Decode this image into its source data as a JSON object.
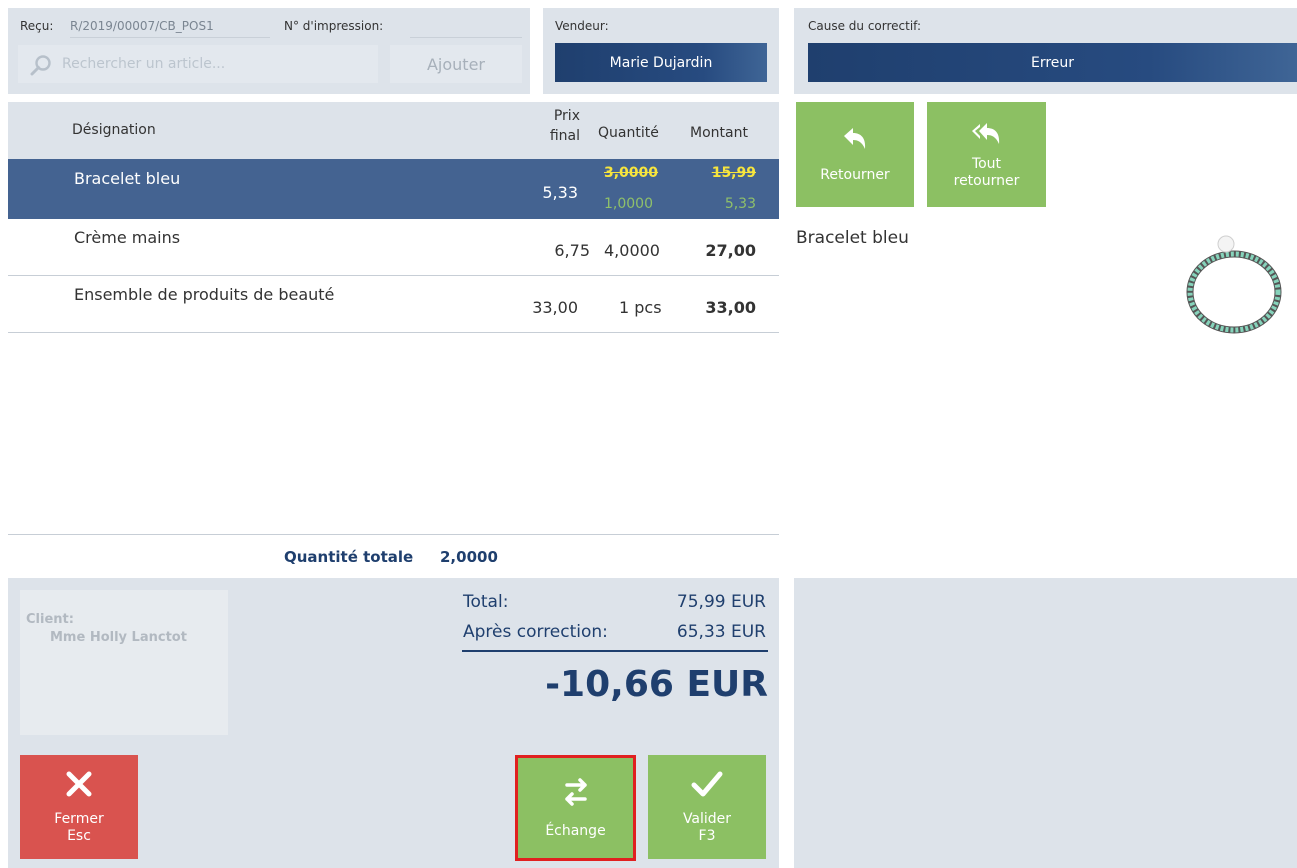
{
  "header": {
    "receipt_label": "Reçu:",
    "receipt_value": "R/2019/00007/CB_POS1",
    "print_label": "N° d'impression:",
    "print_value": "",
    "search_placeholder": "Rechercher un article...",
    "add_button": "Ajouter",
    "seller_label": "Vendeur:",
    "seller_value": "Marie Dujardin",
    "cause_label": "Cause du correctif:",
    "cause_value": "Erreur"
  },
  "table": {
    "col_designation": "Désignation",
    "col_price_line1": "Prix",
    "col_price_line2": "final",
    "col_quantity": "Quantité",
    "col_amount": "Montant",
    "rows": [
      {
        "name": "Bracelet bleu",
        "price": "5,33",
        "qty_old": "3,0000",
        "qty_new": "1,0000",
        "amount_old": "15,99",
        "amount_new": "5,33"
      },
      {
        "name": "Crème mains",
        "price": "6,75",
        "qty": "4,0000",
        "amount": "27,00"
      },
      {
        "name": "Ensemble de produits de beauté",
        "price": "33,00",
        "qty": "1 pcs",
        "amount": "33,00"
      }
    ],
    "total_qty_label": "Quantité totale",
    "total_qty_value": "2,0000"
  },
  "actions": {
    "return_label": "Retourner",
    "return_all_line1": "Tout",
    "return_all_line2": "retourner"
  },
  "preview": {
    "product_name": "Bracelet bleu"
  },
  "client": {
    "label": "Client:",
    "name": "Mme Holly Lanctot"
  },
  "totals": {
    "total_label": "Total:",
    "total_value": "75,99 EUR",
    "after_label": "Après correction:",
    "after_value": "65,33 EUR",
    "difference": "-10,66 EUR"
  },
  "footer": {
    "close_line1": "Fermer",
    "close_line2": "Esc",
    "exchange_label": "Échange",
    "validate_line1": "Valider",
    "validate_line2": "F3"
  },
  "colors": {
    "navy": "#1f3f6e",
    "selected_row": "#446391",
    "green_button": "#8cc063",
    "red_button": "#d9534f",
    "panel": "#dde3ea",
    "highlight_border": "#e02020"
  }
}
